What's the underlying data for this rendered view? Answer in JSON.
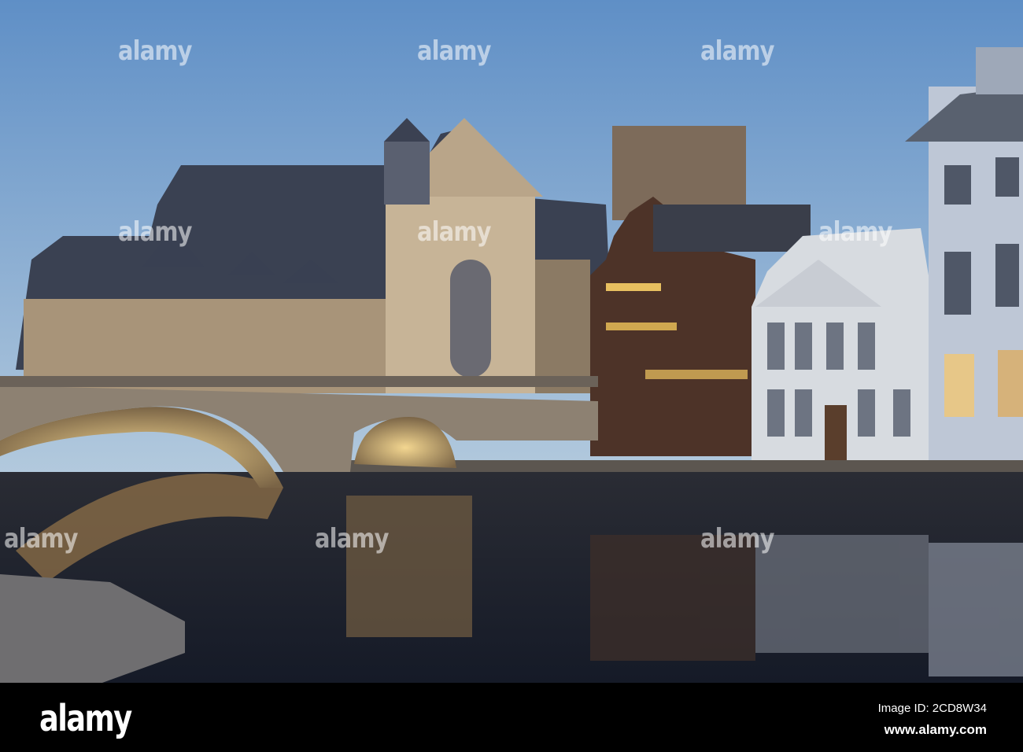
{
  "watermark": {
    "text": "alamy"
  },
  "footer": {
    "logo": "alamy",
    "image_id": "Image ID: 2CD8W34",
    "url": "www.alamy.com"
  },
  "colors": {
    "sky_top": "#5f8fc6",
    "sky_bottom": "#b2c9dd",
    "water": "#1b2232",
    "stone_lit": "#c9b49a",
    "bar": "#000000"
  }
}
